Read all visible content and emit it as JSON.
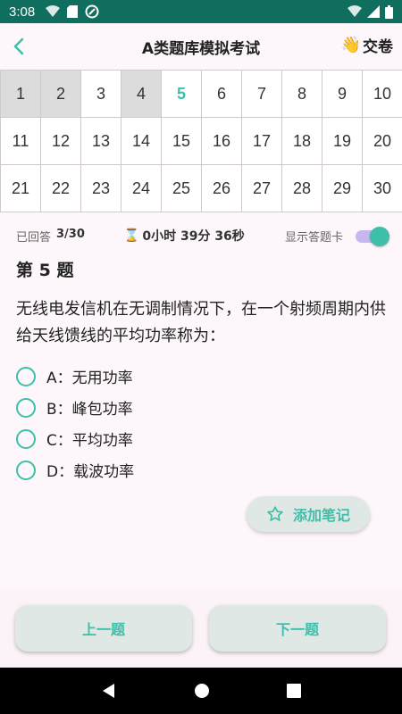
{
  "status_bar": {
    "time": "3:08"
  },
  "app_bar": {
    "title": "A类题库模拟考试",
    "submit_label": "交卷",
    "submit_emoji": "👋"
  },
  "grid": {
    "cells": [
      "1",
      "2",
      "3",
      "4",
      "5",
      "6",
      "7",
      "8",
      "9",
      "10",
      "11",
      "12",
      "13",
      "14",
      "15",
      "16",
      "17",
      "18",
      "19",
      "20",
      "21",
      "22",
      "23",
      "24",
      "25",
      "26",
      "27",
      "28",
      "29",
      "30"
    ],
    "answered": [
      "1",
      "2",
      "4"
    ],
    "current": "5"
  },
  "info": {
    "answered_label": "已回答",
    "answered_value": "3/30",
    "timer_icon": "⌛",
    "timer_value": "0小时 39分 36秒",
    "show_card_label": "显示答题卡",
    "show_card_on": true
  },
  "question": {
    "number": "第 5 题",
    "text": "无线电发信机在无调制情况下，在一个射频周期内供给天线馈线的平均功率称为：",
    "options": [
      {
        "label": "A：无用功率"
      },
      {
        "label": "B：峰包功率"
      },
      {
        "label": "C：平均功率"
      },
      {
        "label": "D：载波功率"
      }
    ]
  },
  "note_button": {
    "label": "添加笔记",
    "icon": "star-outline-icon"
  },
  "navigation": {
    "prev_label": "上一题",
    "next_label": "下一题"
  },
  "colors": {
    "accent": "#3dbfaa",
    "status_bar": "#0f6e5e",
    "answered_cell": "#dcdcdc"
  }
}
